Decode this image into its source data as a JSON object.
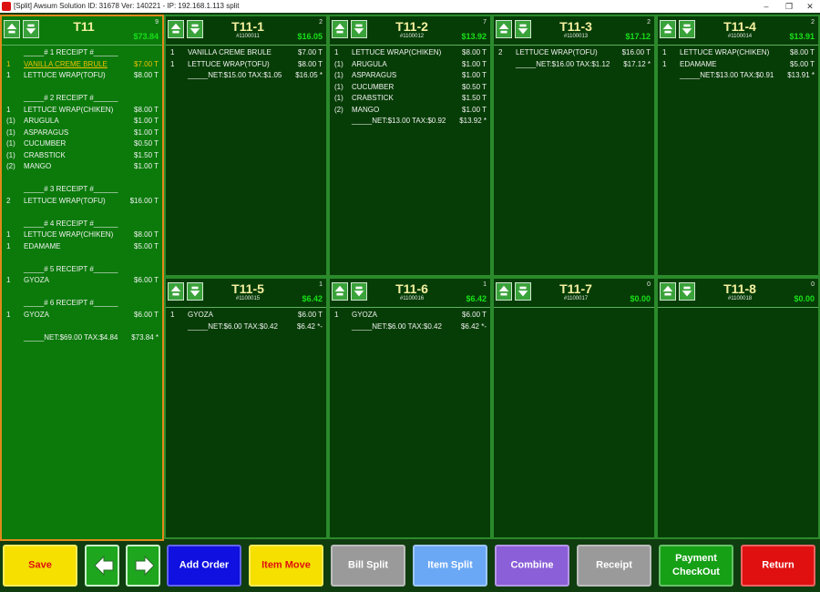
{
  "window": {
    "title": "[Split] Awsum Solution ID: 31678 Ver: 140221 - IP: 192.168.1.113  split",
    "minimize_glyph": "–",
    "restore_glyph": "❐",
    "close_glyph": "✕"
  },
  "colors": {
    "panel_bg": "#063d06",
    "main_panel_bg": "#0b7a0b",
    "main_border": "#e08a1a",
    "total_green": "#19e019",
    "selected_item": "#f0c000"
  },
  "icons": {
    "scroll_up": "scroll-up-icon",
    "scroll_down": "scroll-down-icon",
    "prev": "arrow-left-icon",
    "next": "arrow-right-icon"
  },
  "main": {
    "name": "T11",
    "count": "9",
    "total": "$73.84",
    "lines": [
      {
        "q": "",
        "n": "_____# 1 RECEIPT #______",
        "p": ""
      },
      {
        "q": "1",
        "n": "VANILLA CREME BRULE",
        "p": "$7.00 T",
        "selected": true
      },
      {
        "q": "1",
        "n": "LETTUCE WRAP(TOFU)",
        "p": "$8.00 T"
      },
      {
        "q": "",
        "n": "",
        "p": ""
      },
      {
        "q": "",
        "n": "_____# 2 RECEIPT #______",
        "p": ""
      },
      {
        "q": "1",
        "n": "LETTUCE WRAP(CHIKEN)",
        "p": "$8.00 T"
      },
      {
        "q": "(1)",
        "n": "ARUGULA",
        "p": "$1.00 T"
      },
      {
        "q": "(1)",
        "n": "ASPARAGUS",
        "p": "$1.00 T"
      },
      {
        "q": "(1)",
        "n": "CUCUMBER",
        "p": "$0.50 T"
      },
      {
        "q": "(1)",
        "n": "CRABSTICK",
        "p": "$1.50 T"
      },
      {
        "q": "(2)",
        "n": "MANGO",
        "p": "$1.00 T"
      },
      {
        "q": "",
        "n": "",
        "p": ""
      },
      {
        "q": "",
        "n": "_____# 3 RECEIPT #______",
        "p": ""
      },
      {
        "q": "2",
        "n": "LETTUCE WRAP(TOFU)",
        "p": "$16.00 T"
      },
      {
        "q": "",
        "n": "",
        "p": ""
      },
      {
        "q": "",
        "n": "_____# 4 RECEIPT #______",
        "p": ""
      },
      {
        "q": "1",
        "n": "LETTUCE WRAP(CHIKEN)",
        "p": "$8.00 T"
      },
      {
        "q": "1",
        "n": "EDAMAME",
        "p": "$5.00 T"
      },
      {
        "q": "",
        "n": "",
        "p": ""
      },
      {
        "q": "",
        "n": "_____# 5 RECEIPT #______",
        "p": ""
      },
      {
        "q": "1",
        "n": "GYOZA",
        "p": "$6.00 T"
      },
      {
        "q": "",
        "n": "",
        "p": ""
      },
      {
        "q": "",
        "n": "_____# 6 RECEIPT #______",
        "p": ""
      },
      {
        "q": "1",
        "n": "GYOZA",
        "p": "$6.00 T"
      },
      {
        "q": "",
        "n": "",
        "p": ""
      },
      {
        "q": "",
        "n": "_____NET:$69.00 TAX:$4.84",
        "p": "$73.84 *"
      }
    ]
  },
  "splits": [
    {
      "name": "T11-1",
      "id": "#1100011",
      "count": "2",
      "total": "$16.05",
      "lines": [
        {
          "q": "1",
          "n": "VANILLA CREME BRULE",
          "p": "$7.00 T"
        },
        {
          "q": "1",
          "n": "LETTUCE WRAP(TOFU)",
          "p": "$8.00 T"
        },
        {
          "q": "",
          "n": "_____NET:$15.00 TAX:$1.05",
          "p": "$16.05 *"
        }
      ]
    },
    {
      "name": "T11-2",
      "id": "#1100012",
      "count": "7",
      "total": "$13.92",
      "lines": [
        {
          "q": "1",
          "n": "LETTUCE WRAP(CHIKEN)",
          "p": "$8.00 T"
        },
        {
          "q": "(1)",
          "n": "ARUGULA",
          "p": "$1.00 T"
        },
        {
          "q": "(1)",
          "n": "ASPARAGUS",
          "p": "$1.00 T"
        },
        {
          "q": "(1)",
          "n": "CUCUMBER",
          "p": "$0.50 T"
        },
        {
          "q": "(1)",
          "n": "CRABSTICK",
          "p": "$1.50 T"
        },
        {
          "q": "(2)",
          "n": "MANGO",
          "p": "$1.00 T"
        },
        {
          "q": "",
          "n": "_____NET:$13.00 TAX:$0.92",
          "p": "$13.92 *"
        }
      ]
    },
    {
      "name": "T11-3",
      "id": "#1100013",
      "count": "2",
      "total": "$17.12",
      "lines": [
        {
          "q": "2",
          "n": "LETTUCE WRAP(TOFU)",
          "p": "$16.00 T"
        },
        {
          "q": "",
          "n": "_____NET:$16.00 TAX:$1.12",
          "p": "$17.12 *"
        }
      ]
    },
    {
      "name": "T11-4",
      "id": "#1100014",
      "count": "2",
      "total": "$13.91",
      "lines": [
        {
          "q": "1",
          "n": "LETTUCE WRAP(CHIKEN)",
          "p": "$8.00 T"
        },
        {
          "q": "1",
          "n": "EDAMAME",
          "p": "$5.00 T"
        },
        {
          "q": "",
          "n": "_____NET:$13.00 TAX:$0.91",
          "p": "$13.91 *"
        }
      ]
    },
    {
      "name": "T11-5",
      "id": "#1100015",
      "count": "1",
      "total": "$6.42",
      "lines": [
        {
          "q": "1",
          "n": "GYOZA",
          "p": "$6.00 T"
        },
        {
          "q": "",
          "n": "_____NET:$6.00 TAX:$0.42",
          "p": "$6.42 *-"
        }
      ]
    },
    {
      "name": "T11-6",
      "id": "#1100016",
      "count": "1",
      "total": "$6.42",
      "lines": [
        {
          "q": "1",
          "n": "GYOZA",
          "p": "$6.00 T"
        },
        {
          "q": "",
          "n": "_____NET:$6.00 TAX:$0.42",
          "p": "$6.42 *-"
        }
      ]
    },
    {
      "name": "T11-7",
      "id": "#1100017",
      "count": "0",
      "total": "$0.00",
      "lines": []
    },
    {
      "name": "T11-8",
      "id": "#1100018",
      "count": "0",
      "total": "$0.00",
      "lines": []
    }
  ],
  "buttons": [
    {
      "key": "save",
      "label": "Save",
      "bg": "#f5e000",
      "fg": "#e01010"
    },
    {
      "key": "prev",
      "label": "",
      "icon": "arrow-left-icon"
    },
    {
      "key": "next",
      "label": "",
      "icon": "arrow-right-icon"
    },
    {
      "key": "add-order",
      "label": "Add Order",
      "bg": "#1010e0",
      "fg": "#ffffff"
    },
    {
      "key": "item-move",
      "label": "Item Move",
      "bg": "#f5e000",
      "fg": "#e01010"
    },
    {
      "key": "bill-split",
      "label": "Bill Split",
      "bg": "#9a9a9a",
      "fg": "#ffffff"
    },
    {
      "key": "item-split",
      "label": "Item Split",
      "bg": "#6aa8f5",
      "fg": "#ffffff"
    },
    {
      "key": "combine",
      "label": "Combine",
      "bg": "#8a5fd8",
      "fg": "#ffffff"
    },
    {
      "key": "receipt",
      "label": "Receipt",
      "bg": "#9a9a9a",
      "fg": "#ffffff"
    },
    {
      "key": "payment-checkout",
      "label": "Payment\nCheckOut",
      "bg": "#16a016",
      "fg": "#ffffff"
    },
    {
      "key": "return",
      "label": "Return",
      "bg": "#e01010",
      "fg": "#ffffff"
    }
  ]
}
